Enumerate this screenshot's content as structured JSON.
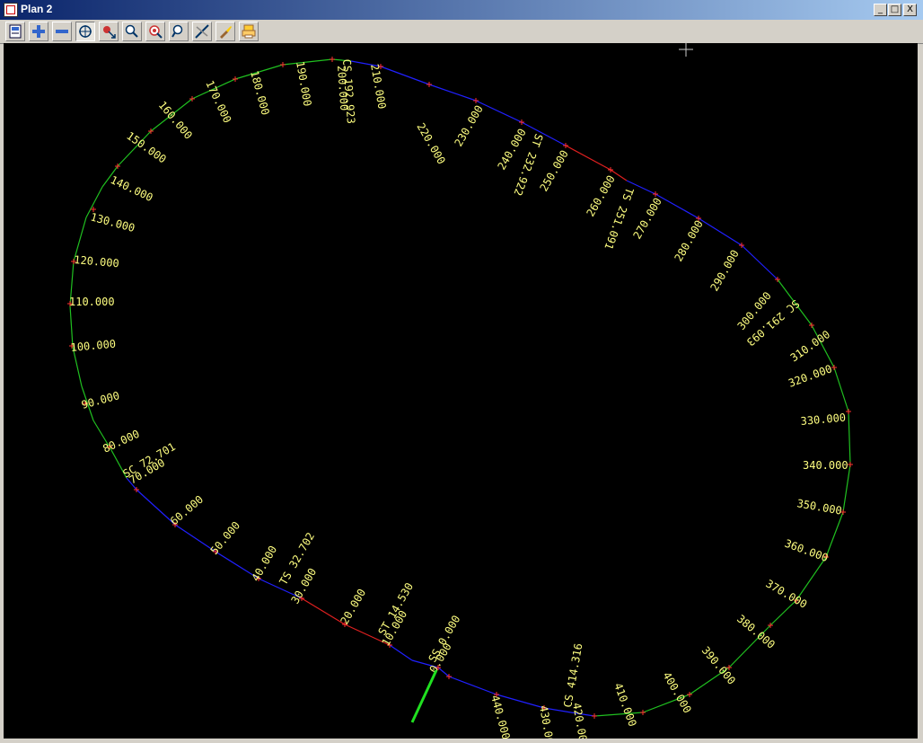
{
  "window": {
    "title": "Plan 2"
  },
  "window_buttons": {
    "minimize": "_",
    "maximize": "□",
    "close": "X"
  },
  "toolbar": {
    "buttons": [
      {
        "name": "save-view-icon"
      },
      {
        "name": "zoom-in-icon"
      },
      {
        "name": "zoom-out-icon"
      },
      {
        "name": "zoom-extent-icon",
        "pressed": true
      },
      {
        "name": "pan-icon"
      },
      {
        "name": "zoom-window-icon"
      },
      {
        "name": "zoom-fit-icon"
      },
      {
        "name": "zoom-previous-icon"
      },
      {
        "name": "measure-icon"
      },
      {
        "name": "pick-icon"
      },
      {
        "name": "plot-icon"
      }
    ]
  },
  "colors": {
    "background": "#000000",
    "straight_segment": "#2020ff",
    "transition_segment": "#e02020",
    "curve_segment": "#20c020",
    "labels": "#ffff80",
    "tick": "#ff3030",
    "start_marker": "#20e020"
  },
  "plan": {
    "chainage_labels": [
      "0.000",
      "10.000",
      "20.000",
      "30.000",
      "40.000",
      "50.000",
      "60.000",
      "70.000",
      "80.000",
      "90.000",
      "100.000",
      "110.000",
      "120.000",
      "130.000",
      "140.000",
      "150.000",
      "160.000",
      "170.000",
      "180.000",
      "190.000",
      "200.000",
      "210.000",
      "220.000",
      "230.000",
      "240.000",
      "250.000",
      "260.000",
      "270.000",
      "280.000",
      "290.000",
      "300.000",
      "310.000",
      "320.000",
      "330.000",
      "340.000",
      "350.000",
      "360.000",
      "370.000",
      "380.000",
      "390.000",
      "400.000",
      "410.000",
      "420.000",
      "430.000",
      "440.000"
    ],
    "key_points": [
      {
        "label": "SS 0.000"
      },
      {
        "label": "ST 14.530"
      },
      {
        "label": "TS 32.702"
      },
      {
        "label": "SC 72.701"
      },
      {
        "label": "CS 192.923"
      },
      {
        "label": "ST 232.922"
      },
      {
        "label": "TS 251.091"
      },
      {
        "label": "SC 291.093"
      },
      {
        "label": "CS 414.316"
      }
    ]
  }
}
